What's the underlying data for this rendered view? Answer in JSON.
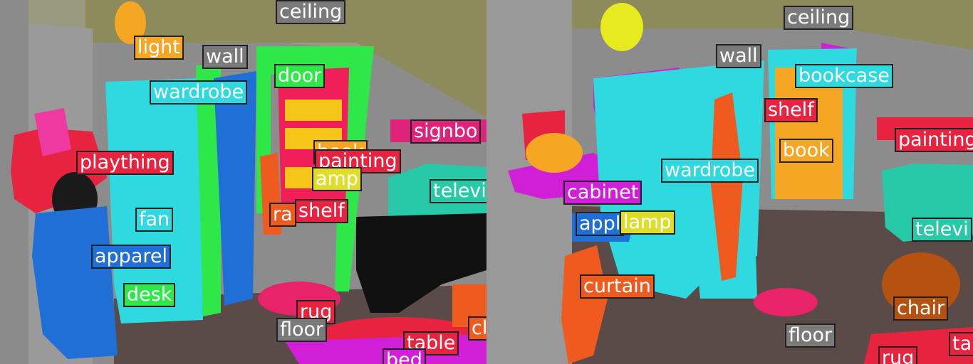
{
  "panels": [
    {
      "name": "left",
      "labels": [
        {
          "text": "ceiling",
          "color": "#7a7a7a"
        },
        {
          "text": "light",
          "color": "#f5a623"
        },
        {
          "text": "wall",
          "color": "#7a7a7a"
        },
        {
          "text": "door",
          "color": "#2ee84a"
        },
        {
          "text": "wardrobe",
          "color": "#2fd9e0"
        },
        {
          "text": "signbo",
          "color": "#e0237a"
        },
        {
          "text": "plaything",
          "color": "#e8233f"
        },
        {
          "text": "book",
          "color": "#f5a623"
        },
        {
          "text": "painting",
          "color": "#e8233f"
        },
        {
          "text": "amp",
          "color": "#dede2a"
        },
        {
          "text": "televi",
          "color": "#28c9a8"
        },
        {
          "text": "fan",
          "color": "#2fd9e0"
        },
        {
          "text": "ra",
          "color": "#ef5a1e"
        },
        {
          "text": "shelf",
          "color": "#e8233f"
        },
        {
          "text": "apparel",
          "color": "#1f6fd6"
        },
        {
          "text": "desk",
          "color": "#2ee84a"
        },
        {
          "text": "rug",
          "color": "#e8233f"
        },
        {
          "text": "floor",
          "color": "#7a7a7a"
        },
        {
          "text": "cl",
          "color": "#ef5a1e"
        },
        {
          "text": "table",
          "color": "#e8233f"
        },
        {
          "text": "bed",
          "color": "#d01fd6"
        }
      ]
    },
    {
      "name": "right",
      "labels": [
        {
          "text": "ceiling",
          "color": "#7a7a7a"
        },
        {
          "text": "wall",
          "color": "#7a7a7a"
        },
        {
          "text": "bookcase",
          "color": "#2fd9e0"
        },
        {
          "text": "shelf",
          "color": "#e8233f"
        },
        {
          "text": "painting",
          "color": "#e8233f"
        },
        {
          "text": "book",
          "color": "#f5a623"
        },
        {
          "text": "wardrobe",
          "color": "#2fd9e0"
        },
        {
          "text": "cabinet",
          "color": "#d01fd6"
        },
        {
          "text": "appl",
          "color": "#1f6fd6"
        },
        {
          "text": "lamp",
          "color": "#dede2a"
        },
        {
          "text": "televi",
          "color": "#28c9a8"
        },
        {
          "text": "curtain",
          "color": "#ef5a1e"
        },
        {
          "text": "chair",
          "color": "#b5520f"
        },
        {
          "text": "floor",
          "color": "#7a7a7a"
        },
        {
          "text": "rug",
          "color": "#e8233f"
        },
        {
          "text": "ta",
          "color": "#e8233f"
        }
      ]
    }
  ]
}
